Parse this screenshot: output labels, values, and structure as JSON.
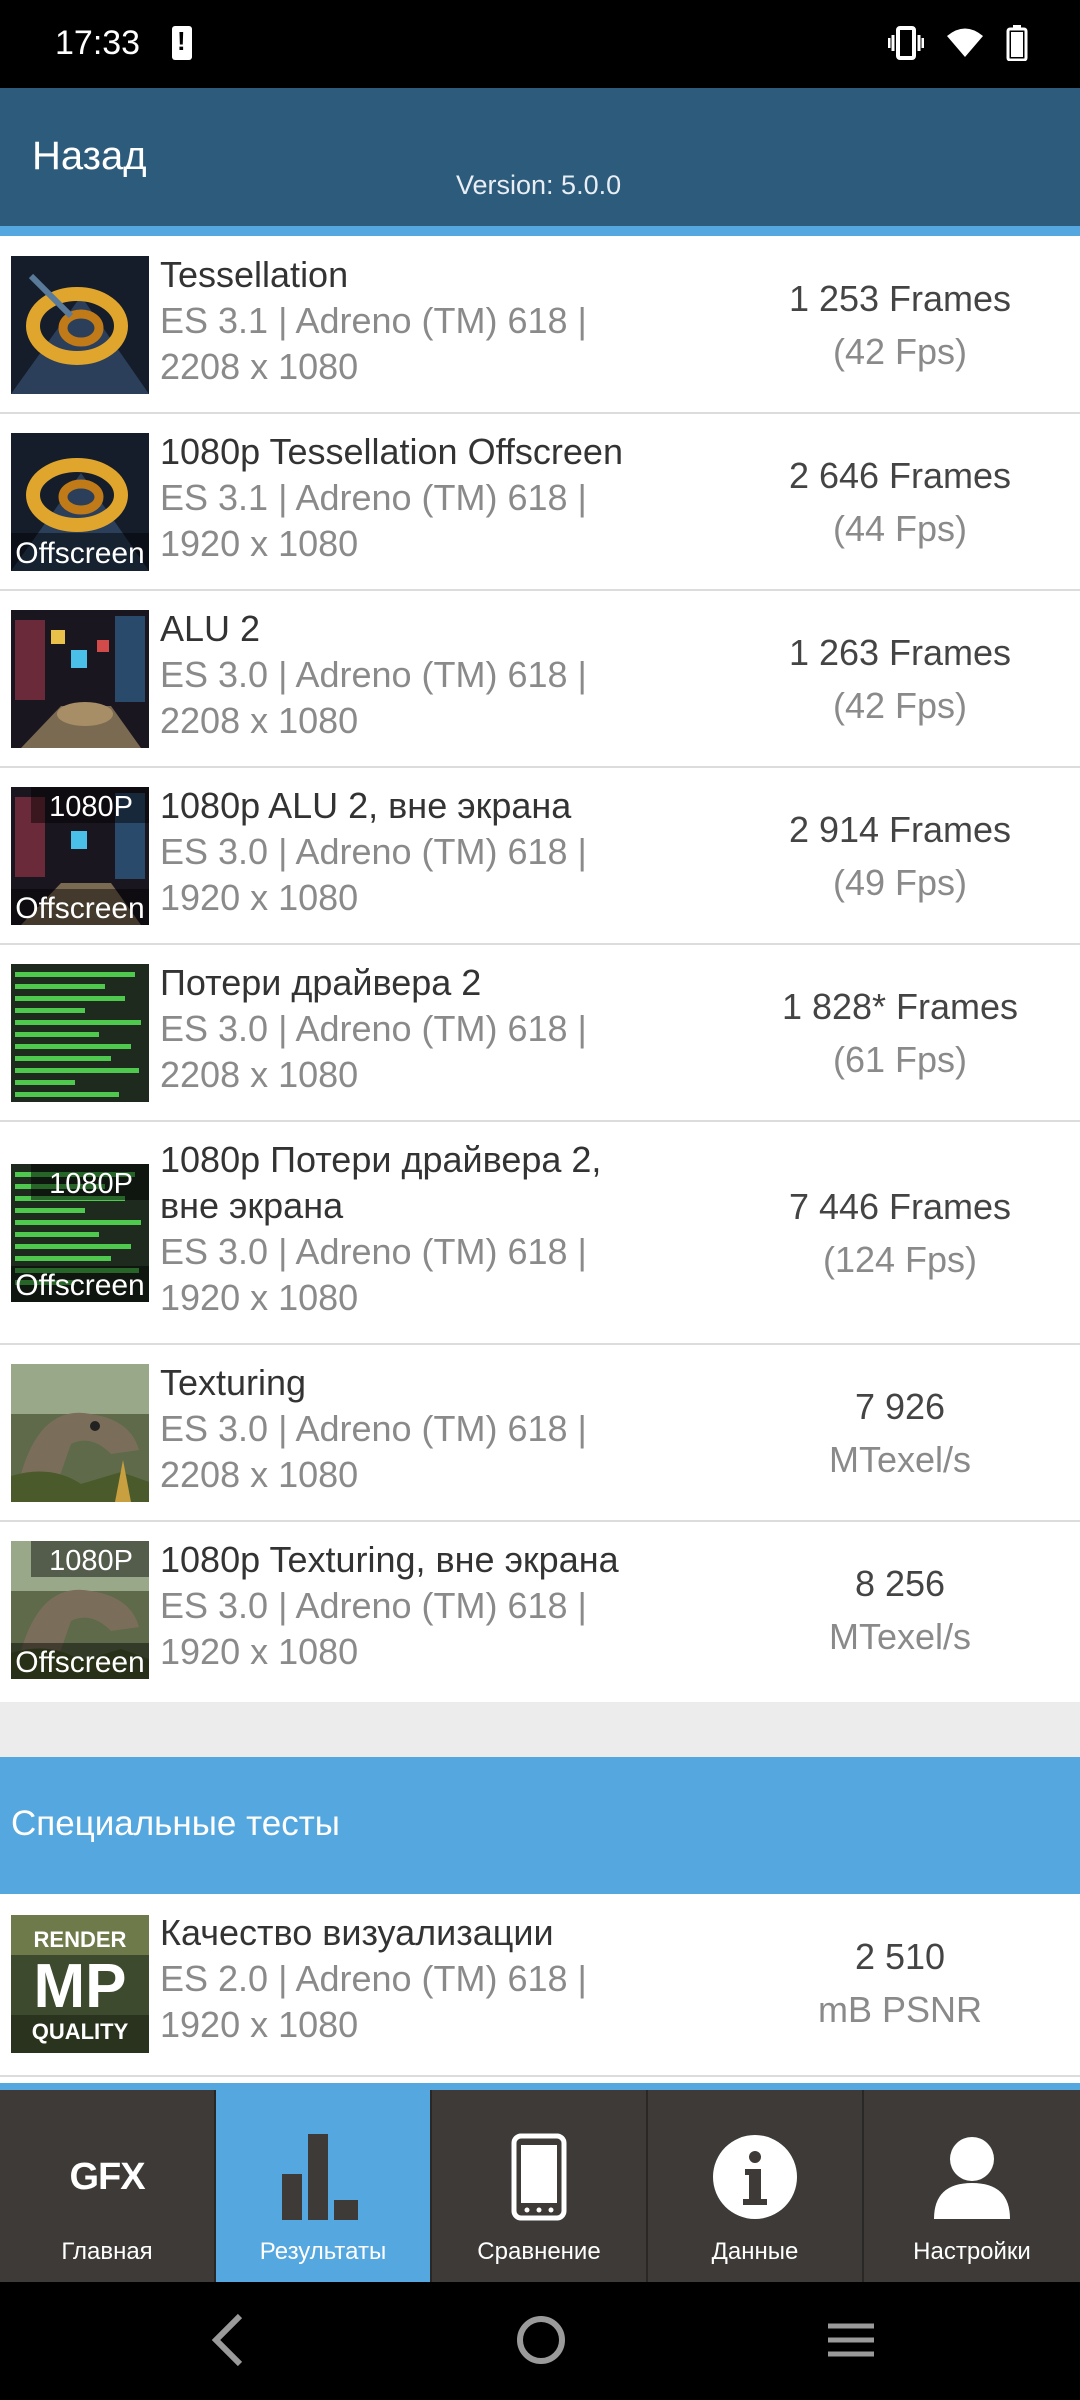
{
  "status": {
    "time": "17:33"
  },
  "header": {
    "back_label": "Назад",
    "version": "Version: 5.0.0"
  },
  "thumb_labels": {
    "offscreen": "Offscreen",
    "p1080": "1080P"
  },
  "tests": [
    {
      "title": "Tessellation",
      "meta1": "ES 3.1 | Adreno (TM) 618 |",
      "meta2": "2208 x 1080",
      "result": "1 253 Frames",
      "result_sub": "(42 Fps)"
    },
    {
      "title": "1080p Tessellation Offscreen",
      "meta1": "ES 3.1 | Adreno (TM) 618 |",
      "meta2": "1920 x 1080",
      "result": "2 646 Frames",
      "result_sub": "(44 Fps)"
    },
    {
      "title": "ALU 2",
      "meta1": "ES 3.0 | Adreno (TM) 618 |",
      "meta2": "2208 x 1080",
      "result": "1 263 Frames",
      "result_sub": "(42 Fps)"
    },
    {
      "title": "1080p ALU 2, вне экрана",
      "meta1": "ES 3.0 | Adreno (TM) 618 |",
      "meta2": "1920 x 1080",
      "result": "2 914 Frames",
      "result_sub": "(49 Fps)"
    },
    {
      "title": "Потери драйвера 2",
      "meta1": "ES 3.0 | Adreno (TM) 618 |",
      "meta2": "2208 x 1080",
      "result": "1 828* Frames",
      "result_sub": "(61 Fps)"
    },
    {
      "title": "1080p Потери драйвера 2,",
      "title2": "вне экрана",
      "meta1": "ES 3.0 | Adreno (TM) 618 |",
      "meta2": "1920 x 1080",
      "result": "7 446 Frames",
      "result_sub": "(124 Fps)"
    },
    {
      "title": "Texturing",
      "meta1": "ES 3.0 | Adreno (TM) 618 |",
      "meta2": "2208 x 1080",
      "result": "7 926",
      "result_sub": "MTexel/s"
    },
    {
      "title": "1080p Texturing, вне экрана",
      "meta1": "ES 3.0 | Adreno (TM) 618 |",
      "meta2": "1920 x 1080",
      "result": "8 256",
      "result_sub": "MTexel/s"
    }
  ],
  "special_section": {
    "title": "Специальные тесты",
    "render_quality_badge": {
      "line1": "RENDER",
      "line2": "MP",
      "line3": "QUALITY"
    },
    "item": {
      "title": "Качество визуализации",
      "meta1": "ES 2.0 | Adreno (TM) 618 |",
      "meta2": "1920 x 1080",
      "result": "2 510",
      "result_sub": "mB PSNR"
    }
  },
  "tabs": [
    {
      "icon_text": "GFX",
      "label": "Главная",
      "active": false
    },
    {
      "label": "Результаты",
      "active": true
    },
    {
      "label": "Сравнение",
      "active": false
    },
    {
      "label": "Данные",
      "active": false
    },
    {
      "label": "Настройки",
      "active": false
    }
  ],
  "colors": {
    "header": "#2c5b7c",
    "accent": "#55a7df",
    "tabbar": "#3d3a37"
  }
}
